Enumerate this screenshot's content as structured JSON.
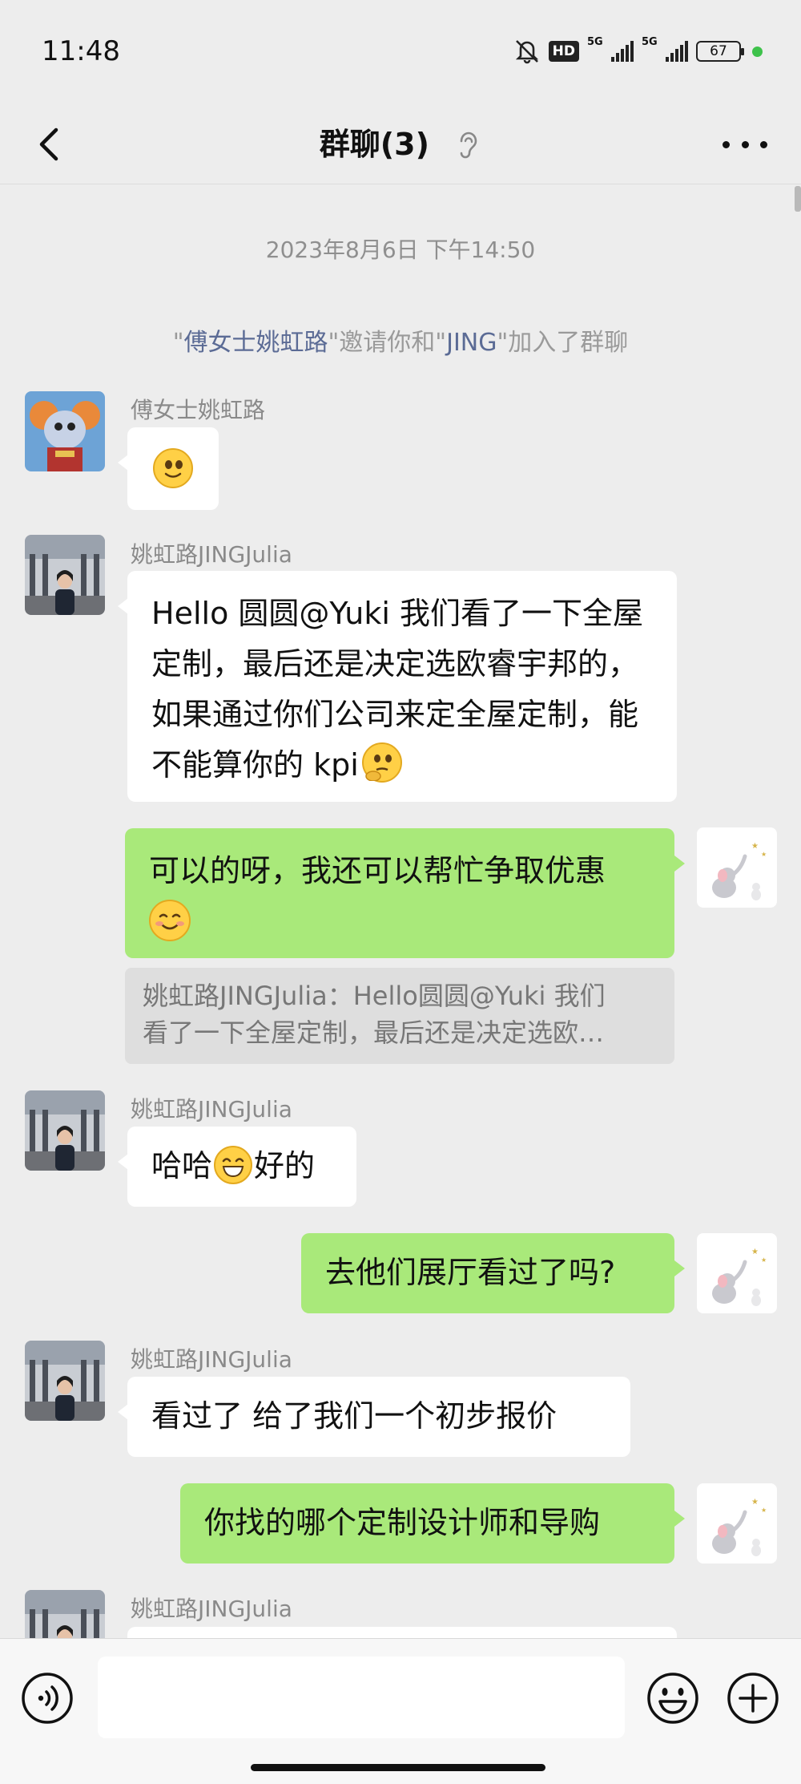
{
  "status_bar": {
    "time": "11:48",
    "hd_label": "HD",
    "sig1_label": "5G",
    "sig2_label": "5G",
    "battery": "67"
  },
  "header": {
    "title": "群聊(3)"
  },
  "chat": {
    "timestamp": "2023年8月6日 下午14:50",
    "system": {
      "q1": "\"",
      "inviter": "傅女士姚虹路",
      "mid": "\"邀请你和\"",
      "invitee": "JING",
      "tail": "\"加入了群聊"
    },
    "messages": [
      {
        "sender": "傅女士姚虹路"
      },
      {
        "sender": "姚虹路JINGJulia",
        "text": "Hello 圆圆@Yuki  我们看了一下全屋定制，最后还是决定选欧睿宇邦的，如果通过你们公司来定全屋定制，能不能算你的 kpi"
      },
      {
        "text": "可以的呀，我还可以帮忙争取优惠",
        "quote": "姚虹路JINGJulia：Hello圆圆@Yuki 我们\n看了一下全屋定制，最后还是决定选欧…"
      },
      {
        "sender": "姚虹路JINGJulia",
        "text_before": "哈哈",
        "text_after": "好的"
      },
      {
        "text": "去他们展厅看过了吗?"
      },
      {
        "sender": "姚虹路JINGJulia",
        "text": "看过了 给了我们一个初步报价"
      },
      {
        "text": "你找的哪个定制设计师和导购"
      },
      {
        "sender": "姚虹路JINGJulia"
      }
    ]
  },
  "input": {
    "placeholder": ""
  },
  "colors": {
    "bubble_out": "#a9e97a",
    "bubble_in": "#ffffff",
    "background": "#ededed",
    "name_link": "#5b6b95"
  }
}
